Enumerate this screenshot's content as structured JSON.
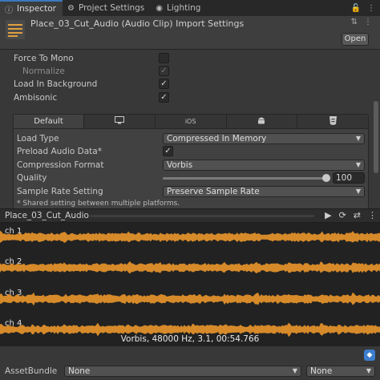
{
  "tabs": [
    {
      "label": "Inspector",
      "icon": "info-icon"
    },
    {
      "label": "Project Settings",
      "icon": "gear-icon"
    },
    {
      "label": "Lighting",
      "icon": "bulb-icon"
    }
  ],
  "header": {
    "title": "Place_03_Cut_Audio (Audio Clip) Import Settings",
    "open_label": "Open"
  },
  "settings": {
    "force_to_mono": {
      "label": "Force To Mono",
      "checked": false
    },
    "normalize": {
      "label": "Normalize",
      "checked": true
    },
    "load_in_background": {
      "label": "Load In Background",
      "checked": true
    },
    "ambisonic": {
      "label": "Ambisonic",
      "checked": true
    }
  },
  "platform_tabs": [
    {
      "label": "Default",
      "icon": ""
    },
    {
      "label": "",
      "icon": "monitor-icon"
    },
    {
      "label": "iOS",
      "icon": ""
    },
    {
      "label": "",
      "icon": "android-icon"
    },
    {
      "label": "",
      "icon": "webgl-icon"
    }
  ],
  "platform": {
    "load_type": {
      "label": "Load Type",
      "value": "Compressed In Memory"
    },
    "preload": {
      "label": "Preload Audio Data*",
      "checked": true
    },
    "compression": {
      "label": "Compression Format",
      "value": "Vorbis"
    },
    "quality": {
      "label": "Quality",
      "value": "100",
      "fraction": 1.0
    },
    "sample_rate": {
      "label": "Sample Rate Setting",
      "value": "Preserve Sample Rate"
    },
    "note": "* Shared setting between multiple platforms."
  },
  "preview": {
    "title": "Place_03_Cut_Audio",
    "channels": [
      "ch 1",
      "ch 2",
      "ch 3",
      "ch 4"
    ],
    "info": "Vorbis, 48000 Hz, 3.1, 00:54.766",
    "wave_color": "#d68a2a"
  },
  "bottom": {
    "assetbundle_label": "AssetBundle",
    "bundle_value": "None",
    "variant_value": "None"
  }
}
